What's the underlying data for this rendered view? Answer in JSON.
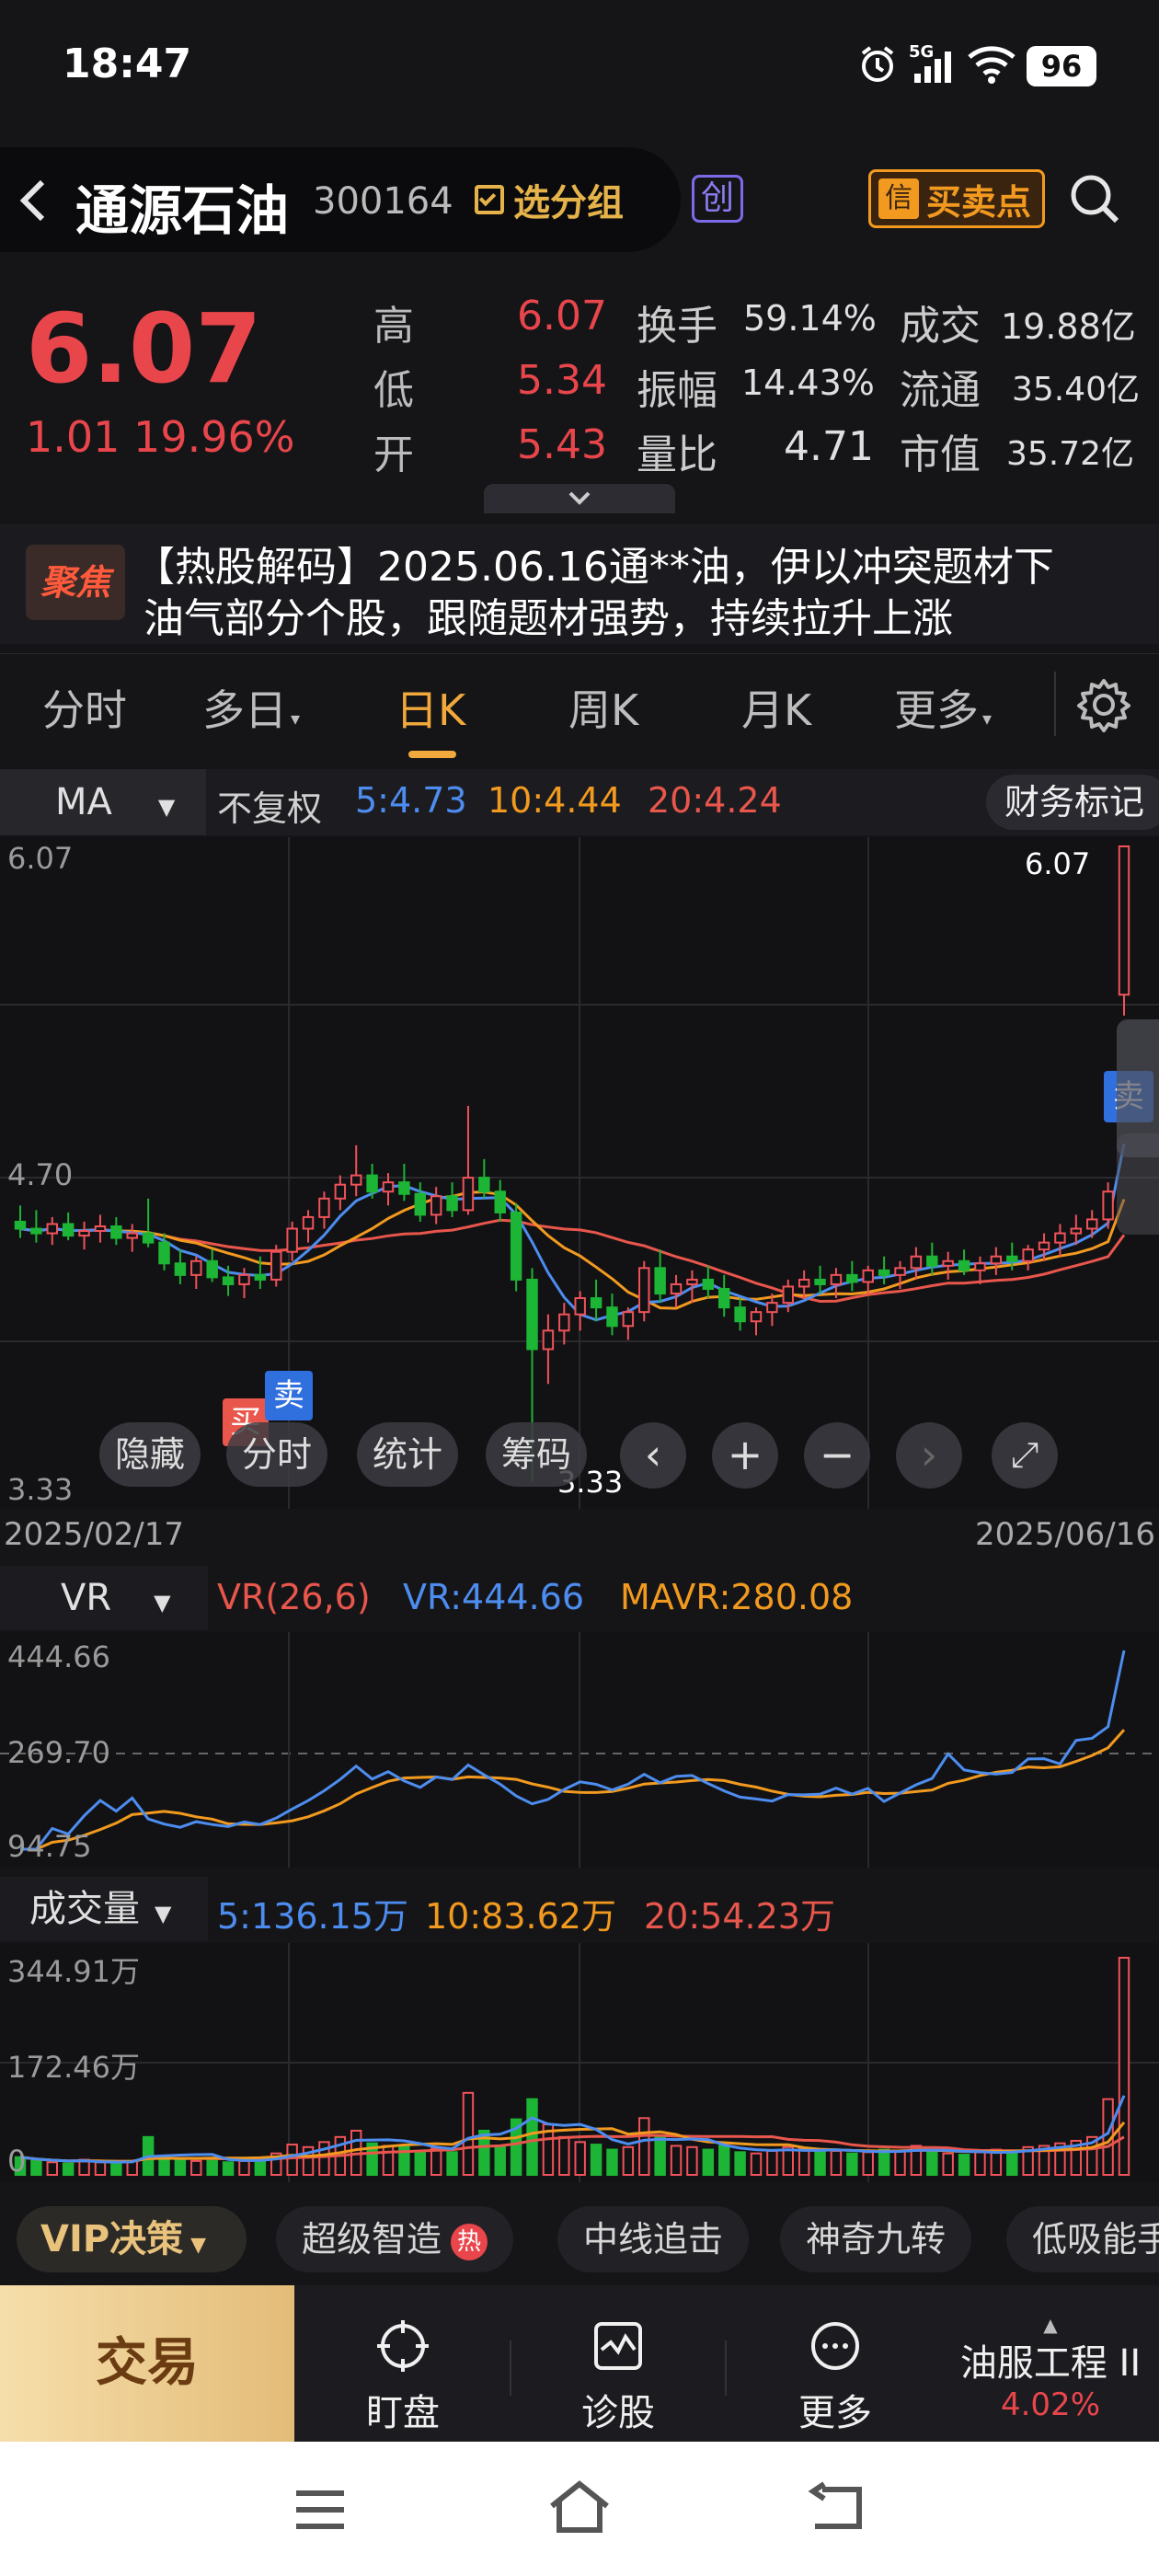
{
  "status": {
    "time": "18:47",
    "network": "5G",
    "battery": "96"
  },
  "header": {
    "title": "通源石油",
    "code": "300164",
    "group_button": "选分组",
    "board_badge": "创",
    "signal_button": "买卖点",
    "signal_icon_text": "信"
  },
  "quote": {
    "price": "6.07",
    "change": "1.01",
    "change_pct": "19.96%",
    "rows": [
      {
        "l1": "高",
        "v1": "6.07",
        "l2": "换手",
        "v2": "59.14%",
        "l3": "成交",
        "v3": "19.88亿"
      },
      {
        "l1": "低",
        "v1": "5.34",
        "l2": "振幅",
        "v2": "14.43%",
        "l3": "流通",
        "v3": "35.40亿"
      },
      {
        "l1": "开",
        "v1": "5.43",
        "l2": "量比",
        "v2": "4.71",
        "l3": "市值",
        "v3": "35.72亿"
      }
    ]
  },
  "news": {
    "badge": "聚焦",
    "line1": "【热股解码】2025.06.16通**油，伊以冲突题材下",
    "line2": "油气部分个股，跟随题材强势，持续拉升上涨"
  },
  "tabs": {
    "fenshi": "分时",
    "duori": "多日",
    "rik": "日K",
    "zhouk": "周K",
    "yuek": "月K",
    "more": "更多"
  },
  "ma_bar": {
    "type": "MA",
    "adjust": "不复权",
    "ma5": "5:4.73",
    "ma10": "10:4.44",
    "ma20": "20:4.24",
    "finance_btn": "财务标记"
  },
  "main_chart": {
    "y_top": "6.07",
    "y_mid": "4.70",
    "y_bottom": "3.33",
    "high_label": "6.07",
    "low_label": "3.33",
    "date_start": "2025/02/17",
    "date_end": "2025/06/16",
    "buy_label": "买",
    "sell_label_1": "卖",
    "sell_label_2": "卖",
    "overlay": {
      "hide": "隐藏",
      "fenshi": "分时",
      "stats": "统计",
      "chips": "筹码"
    }
  },
  "vr_panel": {
    "type": "VR",
    "params": "VR(26,6)",
    "vr": "VR:444.66",
    "mavr": "MAVR:280.08",
    "y_top": "444.66",
    "y_mid": "269.70",
    "y_bottom": "94.75"
  },
  "vol_panel": {
    "type": "成交量",
    "ma5": "5:136.15万",
    "ma10": "10:83.62万",
    "ma20": "20:54.23万",
    "y_top": "344.91万",
    "y_mid": "172.46万",
    "y_bottom": "0"
  },
  "strategy": {
    "vip": "VIP决策",
    "chips": [
      "超级智造",
      "中线追击",
      "神奇九转",
      "低吸能手"
    ],
    "hot_badge": "热"
  },
  "bottom": {
    "trade": "交易",
    "watch": "盯盘",
    "diagnose": "诊股",
    "more": "更多",
    "sector": "油服工程 II",
    "sector_pct": "4.02%"
  },
  "chart_data": {
    "type": "candlestick",
    "x_range": [
      "2025/02/17",
      "2025/06/16"
    ],
    "y_range": [
      3.33,
      6.07
    ],
    "ohlc": [
      [
        4.45,
        4.52,
        4.38,
        4.42
      ],
      [
        4.42,
        4.5,
        4.36,
        4.4
      ],
      [
        4.4,
        4.47,
        4.35,
        4.44
      ],
      [
        4.44,
        4.49,
        4.37,
        4.39
      ],
      [
        4.39,
        4.45,
        4.33,
        4.41
      ],
      [
        4.41,
        4.48,
        4.36,
        4.43
      ],
      [
        4.43,
        4.47,
        4.35,
        4.38
      ],
      [
        4.38,
        4.44,
        4.32,
        4.4
      ],
      [
        4.4,
        4.55,
        4.34,
        4.36
      ],
      [
        4.36,
        4.4,
        4.24,
        4.27
      ],
      [
        4.27,
        4.33,
        4.18,
        4.22
      ],
      [
        4.22,
        4.3,
        4.16,
        4.28
      ],
      [
        4.28,
        4.33,
        4.19,
        4.21
      ],
      [
        4.21,
        4.26,
        4.13,
        4.18
      ],
      [
        4.18,
        4.25,
        4.12,
        4.22
      ],
      [
        4.22,
        4.3,
        4.16,
        4.2
      ],
      [
        4.2,
        4.35,
        4.17,
        4.32
      ],
      [
        4.32,
        4.45,
        4.28,
        4.42
      ],
      [
        4.42,
        4.5,
        4.36,
        4.47
      ],
      [
        4.47,
        4.58,
        4.42,
        4.55
      ],
      [
        4.55,
        4.65,
        4.5,
        4.61
      ],
      [
        4.61,
        4.78,
        4.56,
        4.65
      ],
      [
        4.65,
        4.7,
        4.55,
        4.58
      ],
      [
        4.58,
        4.66,
        4.52,
        4.62
      ],
      [
        4.62,
        4.7,
        4.54,
        4.57
      ],
      [
        4.57,
        4.62,
        4.45,
        4.48
      ],
      [
        4.48,
        4.6,
        4.44,
        4.56
      ],
      [
        4.56,
        4.62,
        4.47,
        4.5
      ],
      [
        4.5,
        4.95,
        4.48,
        4.64
      ],
      [
        4.64,
        4.72,
        4.55,
        4.58
      ],
      [
        4.58,
        4.63,
        4.45,
        4.49
      ],
      [
        4.49,
        4.53,
        4.15,
        4.2
      ],
      [
        4.2,
        4.25,
        3.33,
        3.9
      ],
      [
        3.9,
        4.05,
        3.75,
        3.98
      ],
      [
        3.98,
        4.1,
        3.92,
        4.05
      ],
      [
        4.05,
        4.15,
        3.98,
        4.12
      ],
      [
        4.12,
        4.2,
        4.02,
        4.08
      ],
      [
        4.08,
        4.14,
        3.96,
        4.0
      ],
      [
        4.0,
        4.08,
        3.94,
        4.06
      ],
      [
        4.06,
        4.28,
        4.02,
        4.25
      ],
      [
        4.25,
        4.33,
        4.1,
        4.14
      ],
      [
        4.14,
        4.22,
        4.08,
        4.18
      ],
      [
        4.18,
        4.24,
        4.1,
        4.2
      ],
      [
        4.2,
        4.26,
        4.12,
        4.16
      ],
      [
        4.16,
        4.22,
        4.04,
        4.08
      ],
      [
        4.08,
        4.12,
        3.98,
        4.02
      ],
      [
        4.02,
        4.08,
        3.96,
        4.06
      ],
      [
        4.06,
        4.14,
        4.0,
        4.1
      ],
      [
        4.1,
        4.2,
        4.06,
        4.17
      ],
      [
        4.17,
        4.24,
        4.12,
        4.2
      ],
      [
        4.2,
        4.26,
        4.14,
        4.18
      ],
      [
        4.18,
        4.25,
        4.12,
        4.22
      ],
      [
        4.22,
        4.28,
        4.15,
        4.19
      ],
      [
        4.19,
        4.26,
        4.14,
        4.24
      ],
      [
        4.24,
        4.3,
        4.18,
        4.22
      ],
      [
        4.22,
        4.28,
        4.16,
        4.25
      ],
      [
        4.25,
        4.34,
        4.2,
        4.3
      ],
      [
        4.3,
        4.36,
        4.22,
        4.26
      ],
      [
        4.26,
        4.32,
        4.2,
        4.28
      ],
      [
        4.28,
        4.33,
        4.22,
        4.24
      ],
      [
        4.24,
        4.3,
        4.18,
        4.27
      ],
      [
        4.27,
        4.34,
        4.22,
        4.3
      ],
      [
        4.3,
        4.36,
        4.24,
        4.28
      ],
      [
        4.28,
        4.35,
        4.24,
        4.33
      ],
      [
        4.33,
        4.4,
        4.28,
        4.36
      ],
      [
        4.36,
        4.44,
        4.3,
        4.4
      ],
      [
        4.4,
        4.48,
        4.35,
        4.42
      ],
      [
        4.42,
        4.5,
        4.38,
        4.46
      ],
      [
        4.46,
        4.62,
        4.42,
        4.58
      ],
      [
        5.43,
        6.07,
        5.34,
        6.07
      ]
    ],
    "volume": [
      28,
      22,
      20,
      18,
      24,
      20,
      19,
      22,
      60,
      30,
      26,
      22,
      24,
      20,
      22,
      26,
      34,
      48,
      44,
      52,
      60,
      70,
      50,
      46,
      44,
      38,
      42,
      36,
      130,
      70,
      44,
      88,
      120,
      80,
      60,
      52,
      48,
      40,
      44,
      90,
      60,
      46,
      44,
      40,
      46,
      36,
      34,
      38,
      44,
      42,
      36,
      38,
      34,
      36,
      40,
      38,
      46,
      36,
      34,
      32,
      36,
      40,
      38,
      44,
      46,
      50,
      54,
      60,
      120,
      344
    ]
  }
}
